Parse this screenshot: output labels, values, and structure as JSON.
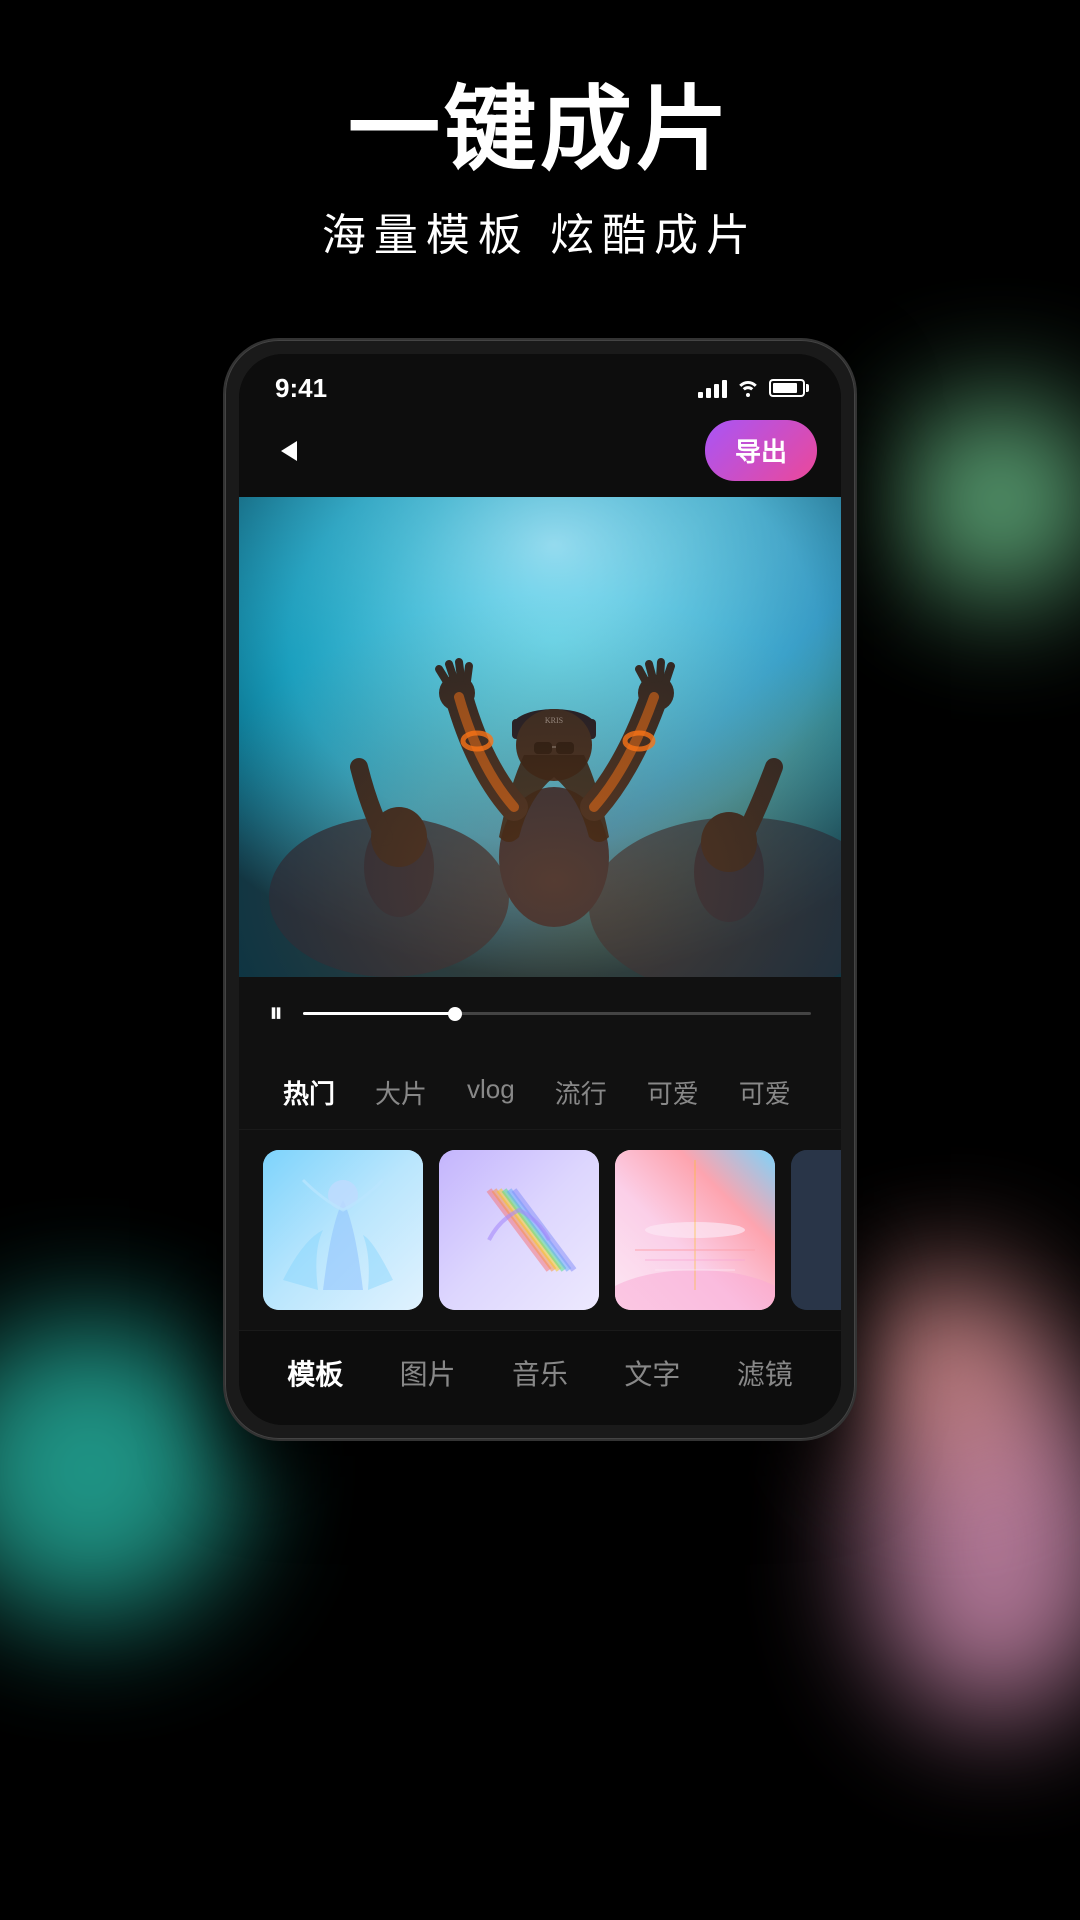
{
  "background": {
    "blobs": [
      "teal",
      "green",
      "pink",
      "peach"
    ]
  },
  "top_section": {
    "main_title": "一键成片",
    "sub_title": "海量模板  炫酷成片"
  },
  "status_bar": {
    "time": "9:41",
    "signal": "signal-icon",
    "wifi": "wifi-icon",
    "battery": "battery-icon"
  },
  "top_bar": {
    "back_label": "‹",
    "export_label": "导出"
  },
  "playback": {
    "pause_icon": "⏸",
    "progress_percent": 30
  },
  "category_tabs": {
    "items": [
      {
        "label": "热门",
        "active": true
      },
      {
        "label": "大片",
        "active": false
      },
      {
        "label": "vlog",
        "active": false
      },
      {
        "label": "流行",
        "active": false
      },
      {
        "label": "可爱",
        "active": false
      },
      {
        "label": "可爱",
        "active": false
      }
    ]
  },
  "templates": {
    "thumbs": [
      {
        "id": 1,
        "class": "thumb-1"
      },
      {
        "id": 2,
        "class": "thumb-2"
      },
      {
        "id": 3,
        "class": "thumb-3"
      },
      {
        "id": 4,
        "class": "thumb-4"
      }
    ]
  },
  "bottom_nav": {
    "items": [
      {
        "label": "模板",
        "active": true
      },
      {
        "label": "图片",
        "active": false
      },
      {
        "label": "音乐",
        "active": false
      },
      {
        "label": "文字",
        "active": false
      },
      {
        "label": "滤镜",
        "active": false
      }
    ]
  }
}
